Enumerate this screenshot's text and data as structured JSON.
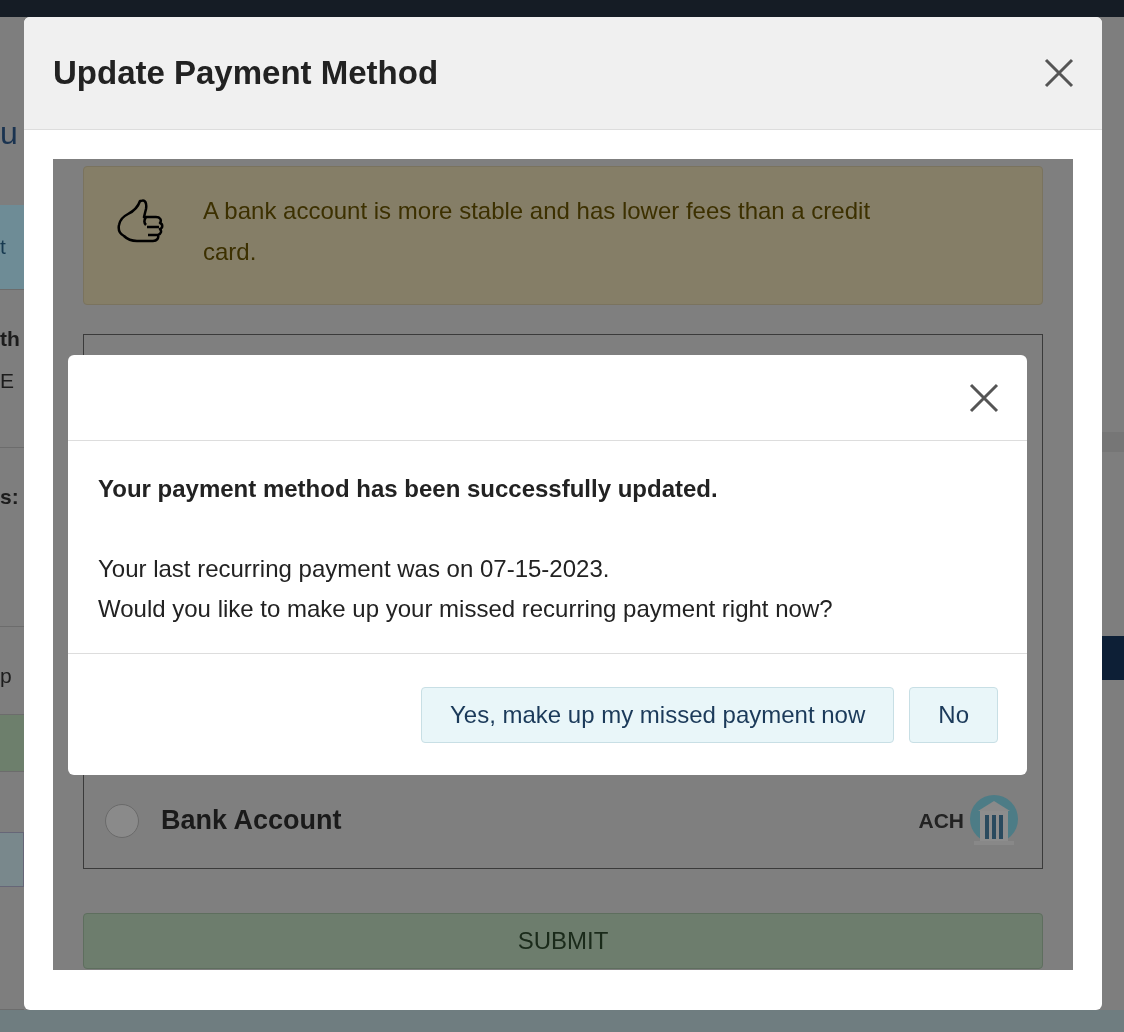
{
  "background_page": {
    "left_rows": [
      {
        "kind": "heading",
        "lines": [
          {
            "text": "u",
            "bold": false
          }
        ]
      },
      {
        "kind": "band",
        "lines": [
          {
            "text": "t",
            "bold": false
          }
        ]
      },
      {
        "kind": "plain",
        "lines": [
          {
            "text": "th",
            "bold": true
          },
          {
            "text": "E",
            "bold": false
          }
        ]
      },
      {
        "kind": "plain",
        "lines": [
          {
            "text": "s:",
            "bold": true
          }
        ]
      },
      {
        "kind": "plain",
        "lines": [
          {
            "text": "p",
            "bold": false
          }
        ]
      },
      {
        "kind": "success",
        "lines": []
      },
      {
        "kind": "outlined",
        "lines": []
      }
    ]
  },
  "dialog": {
    "title": "Update Payment Method",
    "tip": {
      "text": "A bank account is more stable and has lower fees than a credit card."
    },
    "payment_options": [
      {
        "label": "Bank Account",
        "selected": false,
        "badge": "ACH"
      }
    ],
    "submit_button": "SUBMIT"
  },
  "confirmation": {
    "heading": "Your payment method has been successfully updated.",
    "lines": [
      "Your last recurring payment was on 07-15-2023.",
      "Would you like to make up your missed recurring payment right now?"
    ],
    "buttons": [
      "Yes, make up my missed payment now",
      "No"
    ]
  }
}
